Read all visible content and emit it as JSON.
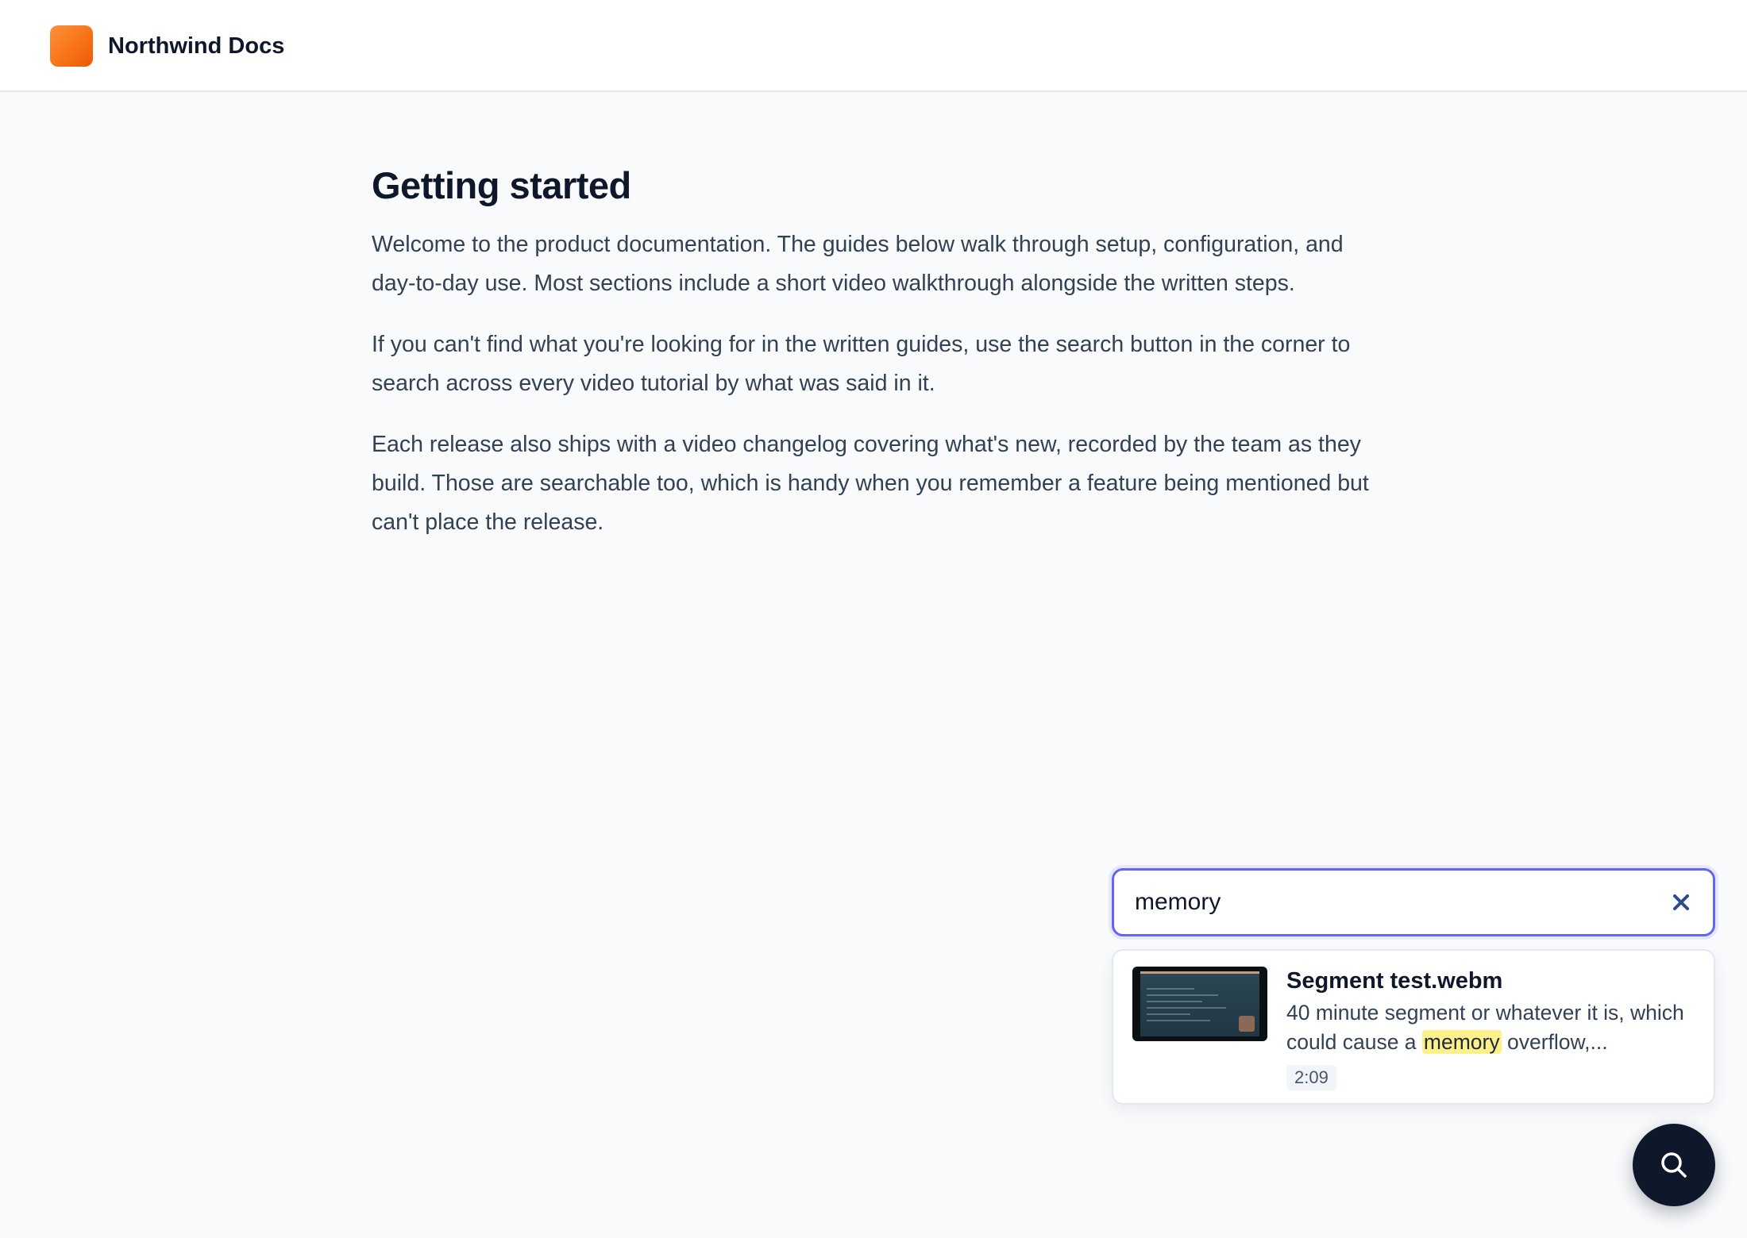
{
  "header": {
    "brand": "Northwind Docs",
    "logo_color": "#f97316"
  },
  "main": {
    "title": "Getting started",
    "paragraphs": [
      "Welcome to the product documentation. The guides below walk through setup, configuration, and day-to-day use. Most sections include a short video walkthrough alongside the written steps.",
      "If you can't find what you're looking for in the written guides, use the search button in the corner to search across every video tutorial by what was said in it.",
      "Each release also ships with a video changelog covering what's new, recorded by the team as they build. Those are searchable too, which is handy when you remember a feature being mentioned but can't place the release."
    ]
  },
  "search": {
    "query": "memory",
    "clear_icon": "close-icon",
    "accent_color": "#6366f1",
    "results": [
      {
        "title": "Segment test.webm",
        "snippet_before": "40 minute segment or whatever it is, which could cause a ",
        "snippet_match": "memory",
        "snippet_after": " overflow,...",
        "duration": "2:09",
        "highlight_color": "#fef08a"
      }
    ]
  },
  "fab": {
    "icon": "search-icon",
    "color": "#0f172a"
  }
}
